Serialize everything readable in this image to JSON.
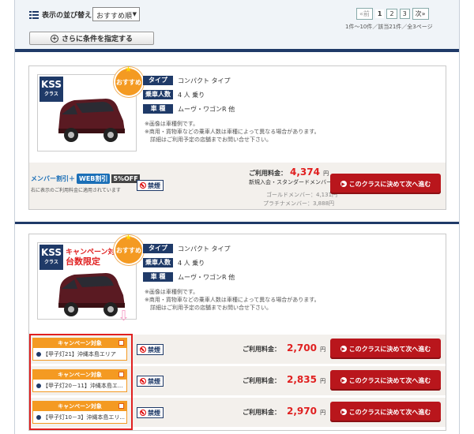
{
  "toolbar": {
    "sort_label": "表示の並び替え",
    "sort_value": "おすすめ順",
    "more_conditions_label": "さらに条件を指定する"
  },
  "pager": {
    "prev": "前",
    "pages": [
      "1",
      "2",
      "3"
    ],
    "next": "次",
    "info": "1件～10件／該当21件／全3ページ"
  },
  "cards": [
    {
      "class_name": "KSS",
      "class_sub": "クラス",
      "badge": "おすすめ",
      "specs": [
        {
          "key": "タイプ",
          "value": "コンパクト タイプ"
        },
        {
          "key": "乗車人数",
          "value": "4 人 乗り"
        },
        {
          "key": "車 種",
          "value": "ムーヴ・ワゴンR 他"
        }
      ],
      "notes": [
        "※画像は車種例です。",
        "※商用・貨物車などの乗車人数は車種によって異なる場合があります。",
        "　詳細はご利用予定の店舗までお問い合せ下さい。"
      ],
      "member_discount": "メンバー割引＋",
      "web_discount": "WEB割引",
      "off_label": "5%OFF",
      "member_note": "右に表示のご利用料金に適用されています",
      "no_smoking": "禁煙",
      "price_label": "ご利用料金：",
      "price": "4,374",
      "price_unit": "円",
      "member_type": "新規入会・スタンダードメンバー",
      "gold_price": "ゴールドメンバー：4,131円",
      "platinum_price": "プラチナメンバー：3,888円",
      "button": "このクラスに決めて次へ進む"
    },
    {
      "class_name": "KSS",
      "class_sub": "クラス",
      "badge": "おすすめ",
      "campaign_line1": "キャンペーン対",
      "campaign_line2": "台数限定",
      "specs": [
        {
          "key": "タイプ",
          "value": "コンパクト タイプ"
        },
        {
          "key": "乗車人数",
          "value": "4 人 乗り"
        },
        {
          "key": "車 種",
          "value": "ムーヴ・ワゴンR 他"
        }
      ],
      "notes": [
        "※画像は車種例です。",
        "※商用・貨物車などの乗車人数は車種によって異なる場合があります。",
        "　詳細はご利用予定の店舗までお問い合せ下さい。"
      ],
      "campaigns": [
        {
          "tag": "キャンペーン対象",
          "name": "【甲子灯21】沖縄本島エリア",
          "no_smoking": "禁煙",
          "price_label": "ご利用料金：",
          "price": "2,700",
          "price_unit": "円",
          "button": "このクラスに決めて次へ進む"
        },
        {
          "tag": "キャンペーン対象",
          "name": "【甲子灯20－11】沖縄本島エ...",
          "no_smoking": "禁煙",
          "price_label": "ご利用料金：",
          "price": "2,835",
          "price_unit": "円",
          "button": "このクラスに決めて次へ進む"
        },
        {
          "tag": "キャンペーン対象",
          "name": "【甲子灯10－3】沖縄本島エリ...",
          "no_smoking": "禁煙",
          "price_label": "ご利用料金：",
          "price": "2,970",
          "price_unit": "円",
          "button": "このクラスに決めて次へ進む"
        }
      ]
    }
  ],
  "colors": {
    "navy": "#1f3a68",
    "accent_red": "#e02020",
    "button_red": "#b9161c",
    "orange": "#f49a22"
  }
}
